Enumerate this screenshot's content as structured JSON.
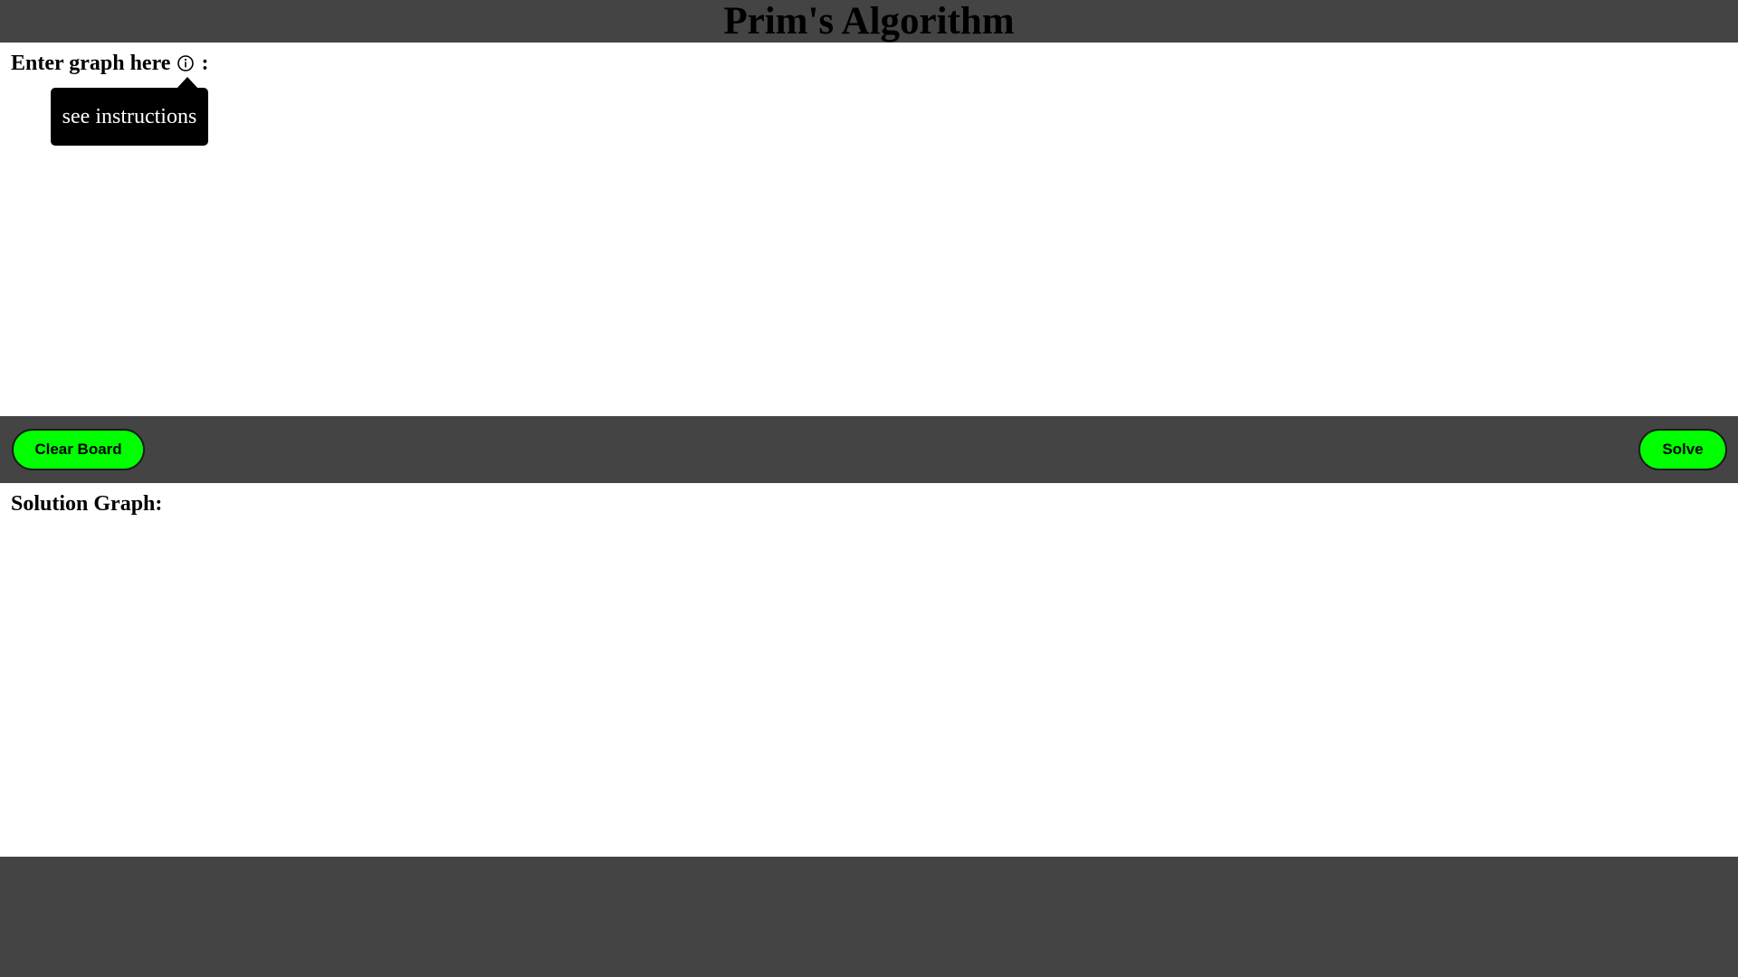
{
  "page": {
    "title": "Prim's Algorithm"
  },
  "input_panel": {
    "label": "Enter graph here",
    "label_suffix": ":",
    "info_icon": "info-circle-icon",
    "tooltip": "see instructions"
  },
  "toolbar": {
    "clear_label": "Clear Board",
    "solve_label": "Solve"
  },
  "solution_panel": {
    "label": "Solution Graph:"
  },
  "colors": {
    "background": "#444444",
    "panel": "#ffffff",
    "button": "#00ff00",
    "tooltip_bg": "#000000"
  }
}
